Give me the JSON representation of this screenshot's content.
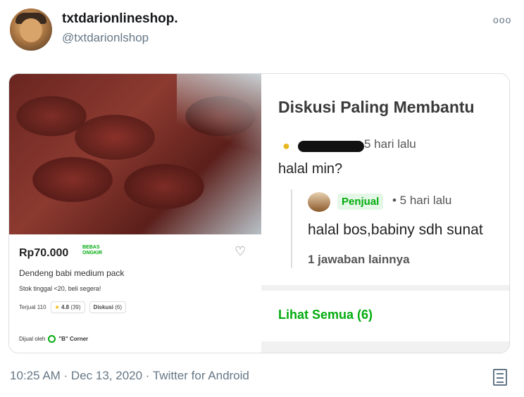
{
  "tweet": {
    "display_name": "txtdarionlineshop.",
    "handle": "@txtdarionlshop",
    "more_icon": "more-dots-icon",
    "timestamp": "10:25 AM · Dec 13, 2020 · Twitter for Android"
  },
  "product": {
    "price": "Rp70.000",
    "free_shipping_line1": "BEBAS",
    "free_shipping_line2": "ONGKIR",
    "name": "Dendeng babi medium pack",
    "stock": "Stok tinggal <20, beli segera!",
    "sold": "Terjual 110",
    "rating": "4.8",
    "rating_count": "(39)",
    "discussion_label": "Diskusi",
    "discussion_count": "(6)",
    "seller_prefix": "Dijual oleh",
    "seller_name": "\"B\" Corner"
  },
  "discussion": {
    "title": "Diskusi Paling Membantu",
    "question_time": "5 hari lalu",
    "question": "halal min?",
    "seller_badge": "Penjual",
    "reply_time": "• 5 hari lalu",
    "reply": "halal bos,babiny sdh sunat",
    "more_answers": "1 jawaban lainnya",
    "see_all": "Lihat Semua (6)"
  },
  "colors": {
    "accent_green": "#03ac0e",
    "secondary_text": "#657786"
  }
}
